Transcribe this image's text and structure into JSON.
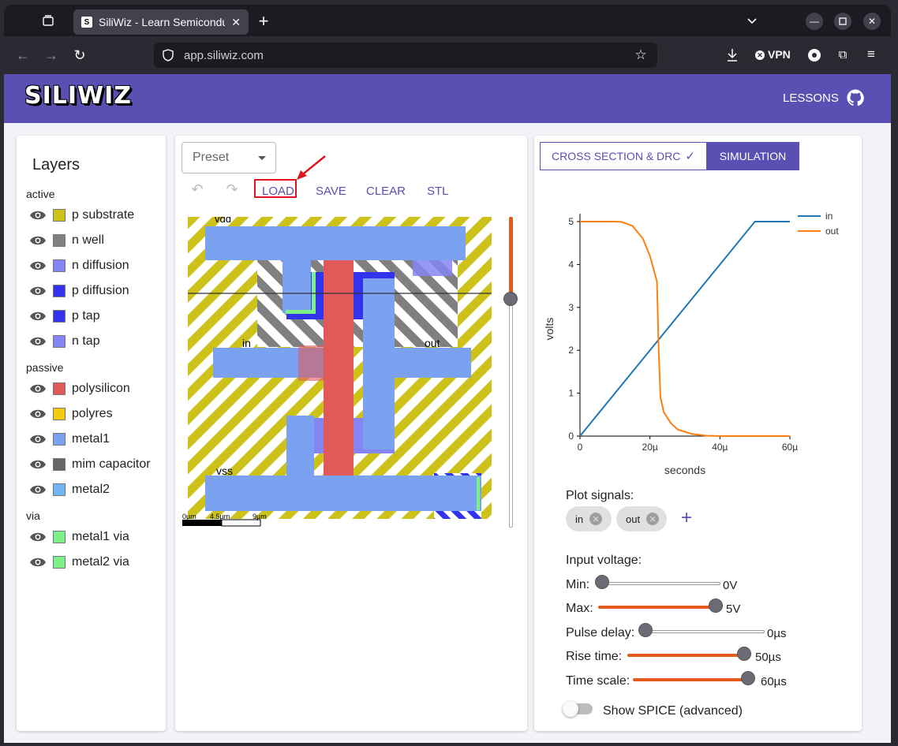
{
  "browser": {
    "tab_title": "SiliWiz - Learn Semicondu",
    "tab_favicon": "S",
    "url": "app.siliwiz.com",
    "vpn_label": "VPN"
  },
  "header": {
    "logo": "SILIWIZ",
    "lessons": "LESSONS",
    "brand_color": "#5a4fb3"
  },
  "layers": {
    "title": "Layers",
    "groups": [
      {
        "name": "active",
        "items": [
          {
            "label": "p substrate",
            "color": "#cdc21a"
          },
          {
            "label": "n well",
            "color": "#808080"
          },
          {
            "label": "n diffusion",
            "color": "#8585f5"
          },
          {
            "label": "p diffusion",
            "color": "#3333ee"
          },
          {
            "label": "p tap",
            "color": "#3333ee"
          },
          {
            "label": "n tap",
            "color": "#8585f5"
          }
        ]
      },
      {
        "name": "passive",
        "items": [
          {
            "label": "polysilicon",
            "color": "#e05a5a"
          },
          {
            "label": "polyres",
            "color": "#f2cc0c"
          },
          {
            "label": "metal1",
            "color": "#7aa2f0"
          },
          {
            "label": "mim capacitor",
            "color": "#666666"
          },
          {
            "label": "metal2",
            "color": "#6fb6f3"
          }
        ]
      },
      {
        "name": "via",
        "items": [
          {
            "label": "metal1 via",
            "color": "#7ef08a"
          },
          {
            "label": "metal2 via",
            "color": "#7ef08a"
          }
        ]
      }
    ]
  },
  "editor": {
    "preset_label": "Preset",
    "toolbar": {
      "load": "LOAD",
      "save": "SAVE",
      "clear": "CLEAR",
      "stl": "STL"
    },
    "labels": {
      "vdd": "vdd",
      "in": "in",
      "out": "out",
      "vss": "vss"
    },
    "scale": {
      "t0": "0µm",
      "t1": "4.5µm",
      "t2": "9µm"
    }
  },
  "sim": {
    "tab1": "CROSS SECTION & DRC",
    "tab2": "SIMULATION",
    "plot_signals": "Plot signals:",
    "chip_in": "in",
    "chip_out": "out",
    "input_voltage": "Input voltage:",
    "min_label": "Min:",
    "min_val": "0V",
    "max_label": "Max:",
    "max_val": "5V",
    "pulse_label": "Pulse delay:",
    "pulse_val": "0µs",
    "rise_label": "Rise time:",
    "rise_val": "50µs",
    "scale_label": "Time scale:",
    "scale_val": "60µs",
    "show_spice": "Show SPICE (advanced)",
    "levels": {
      "min": 0.0,
      "max": 1.0,
      "pulse": 0.0,
      "rise": 0.83,
      "scale": 1.0
    }
  },
  "chart_data": {
    "type": "line",
    "xlabel": "seconds",
    "ylabel": "volts",
    "xlim": [
      0,
      60
    ],
    "ylim": [
      0,
      5
    ],
    "xticks": [
      "0",
      "20µ",
      "40µ",
      "60µ"
    ],
    "yticks": [
      "0",
      "1",
      "2",
      "3",
      "4",
      "5"
    ],
    "legend": "top-right",
    "series": [
      {
        "name": "in",
        "color": "#1f77b4",
        "x": [
          0,
          50,
          60
        ],
        "y": [
          0,
          5,
          5
        ]
      },
      {
        "name": "out",
        "color": "#ff7f0e",
        "x": [
          0,
          10,
          12,
          15,
          18,
          20,
          21,
          22,
          22.5,
          23,
          24,
          26,
          28,
          32,
          36,
          40,
          60
        ],
        "y": [
          5,
          5,
          4.99,
          4.9,
          4.6,
          4.2,
          3.9,
          3.6,
          2.0,
          0.9,
          0.55,
          0.3,
          0.15,
          0.05,
          0.01,
          0,
          0
        ]
      }
    ]
  }
}
